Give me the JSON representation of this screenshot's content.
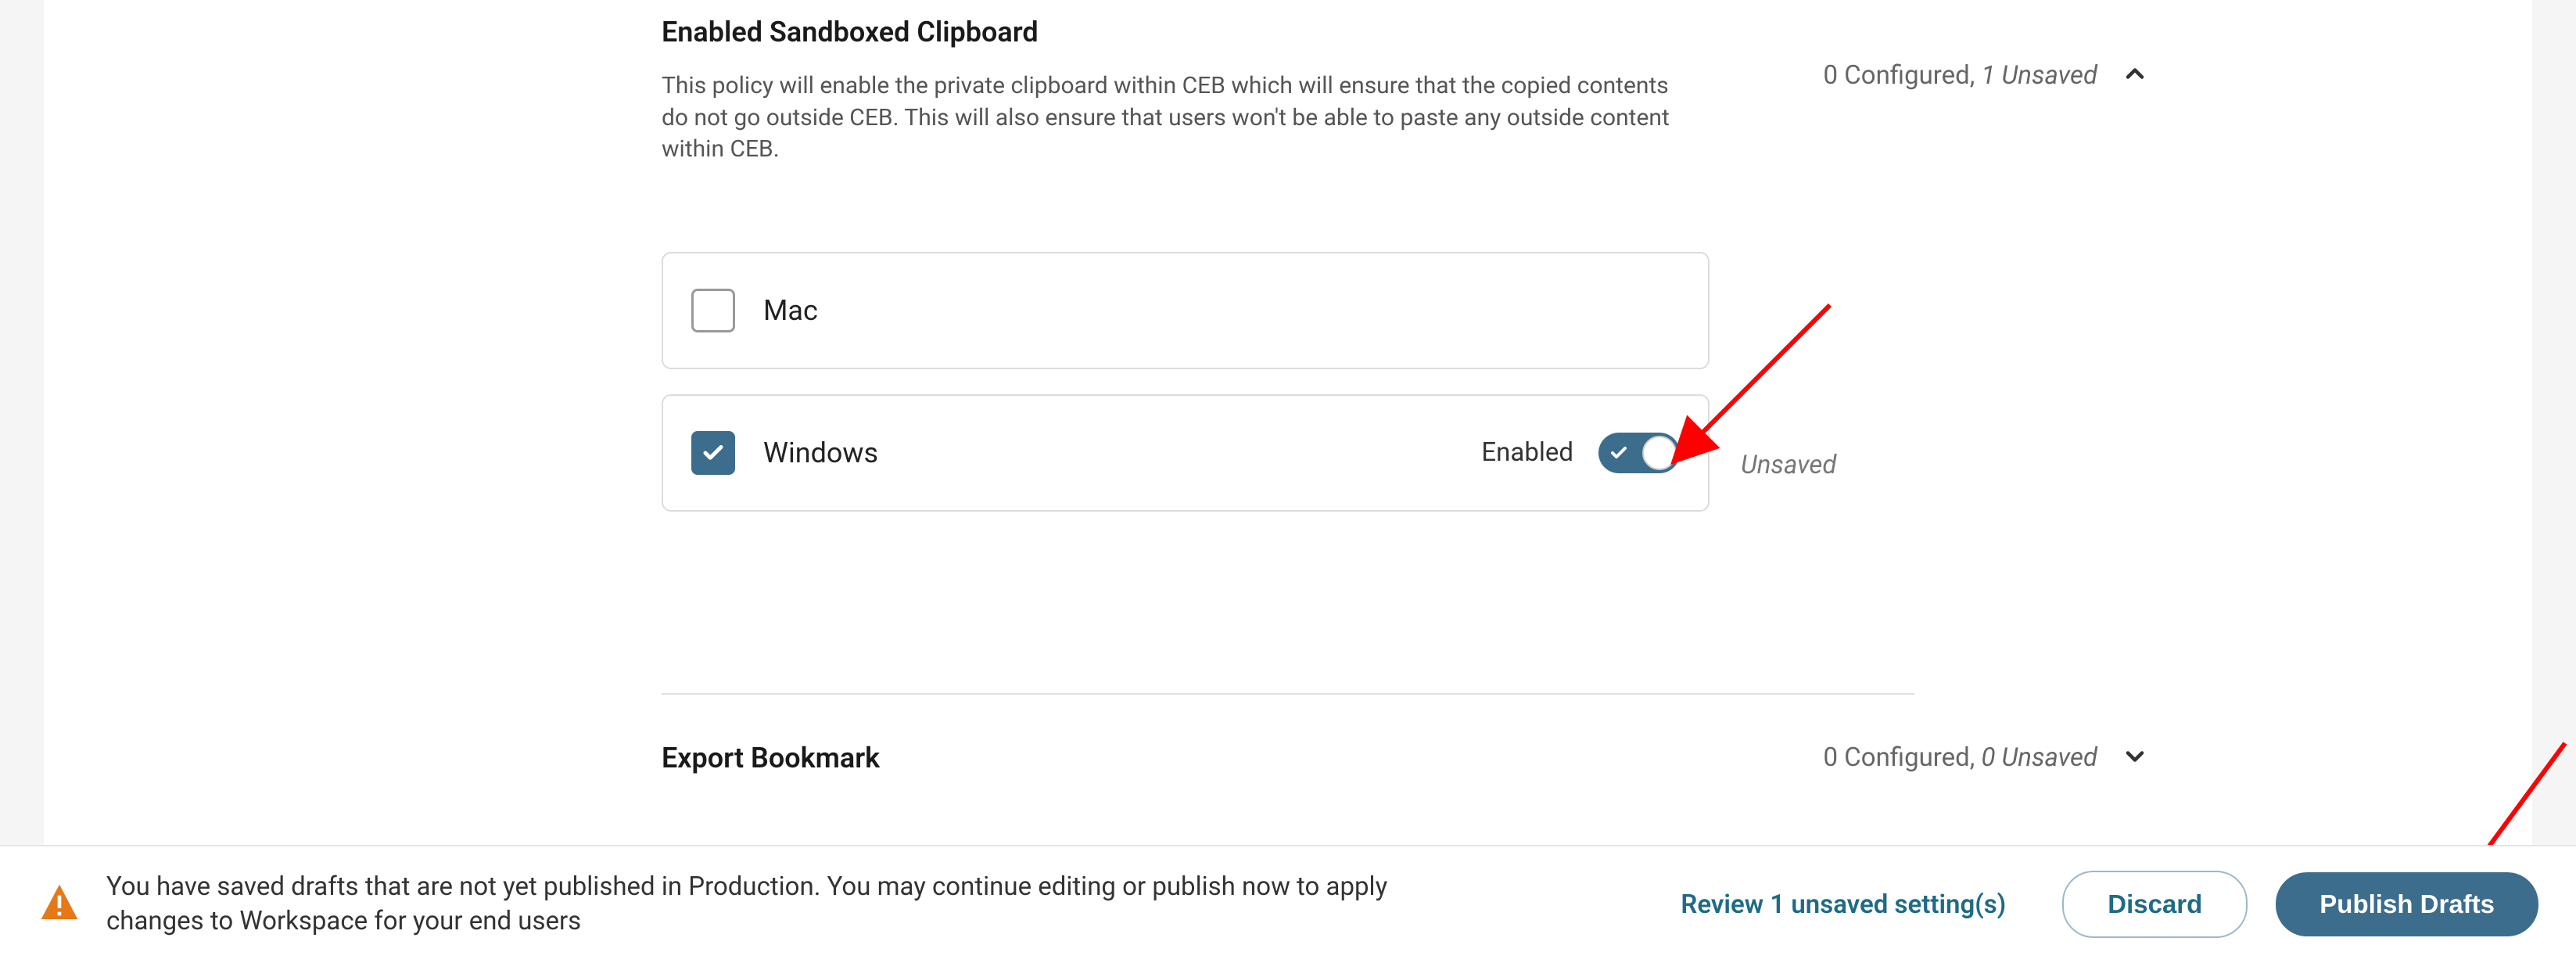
{
  "section1": {
    "title": "Enabled Sandboxed Clipboard",
    "description": "This policy will enable the private clipboard within CEB which will ensure that the copied contents do not go outside CEB. This will also ensure that users won't be able to paste any outside content within CEB.",
    "status_configured": "0 Configured,",
    "status_unsaved": "1 Unsaved",
    "options": {
      "mac": {
        "label": "Mac"
      },
      "windows": {
        "label": "Windows",
        "enabled_label": "Enabled",
        "unsaved_label": "Unsaved"
      }
    }
  },
  "section2": {
    "title": "Export Bookmark",
    "status_configured": "0 Configured,",
    "status_unsaved": "0 Unsaved"
  },
  "bottom_bar": {
    "message": "You have saved drafts that are not yet published in Production. You may continue editing or publish now to apply changes to Workspace for your end users",
    "review_link": "Review 1 unsaved setting(s)",
    "discard_label": "Discard",
    "publish_label": "Publish Drafts"
  }
}
